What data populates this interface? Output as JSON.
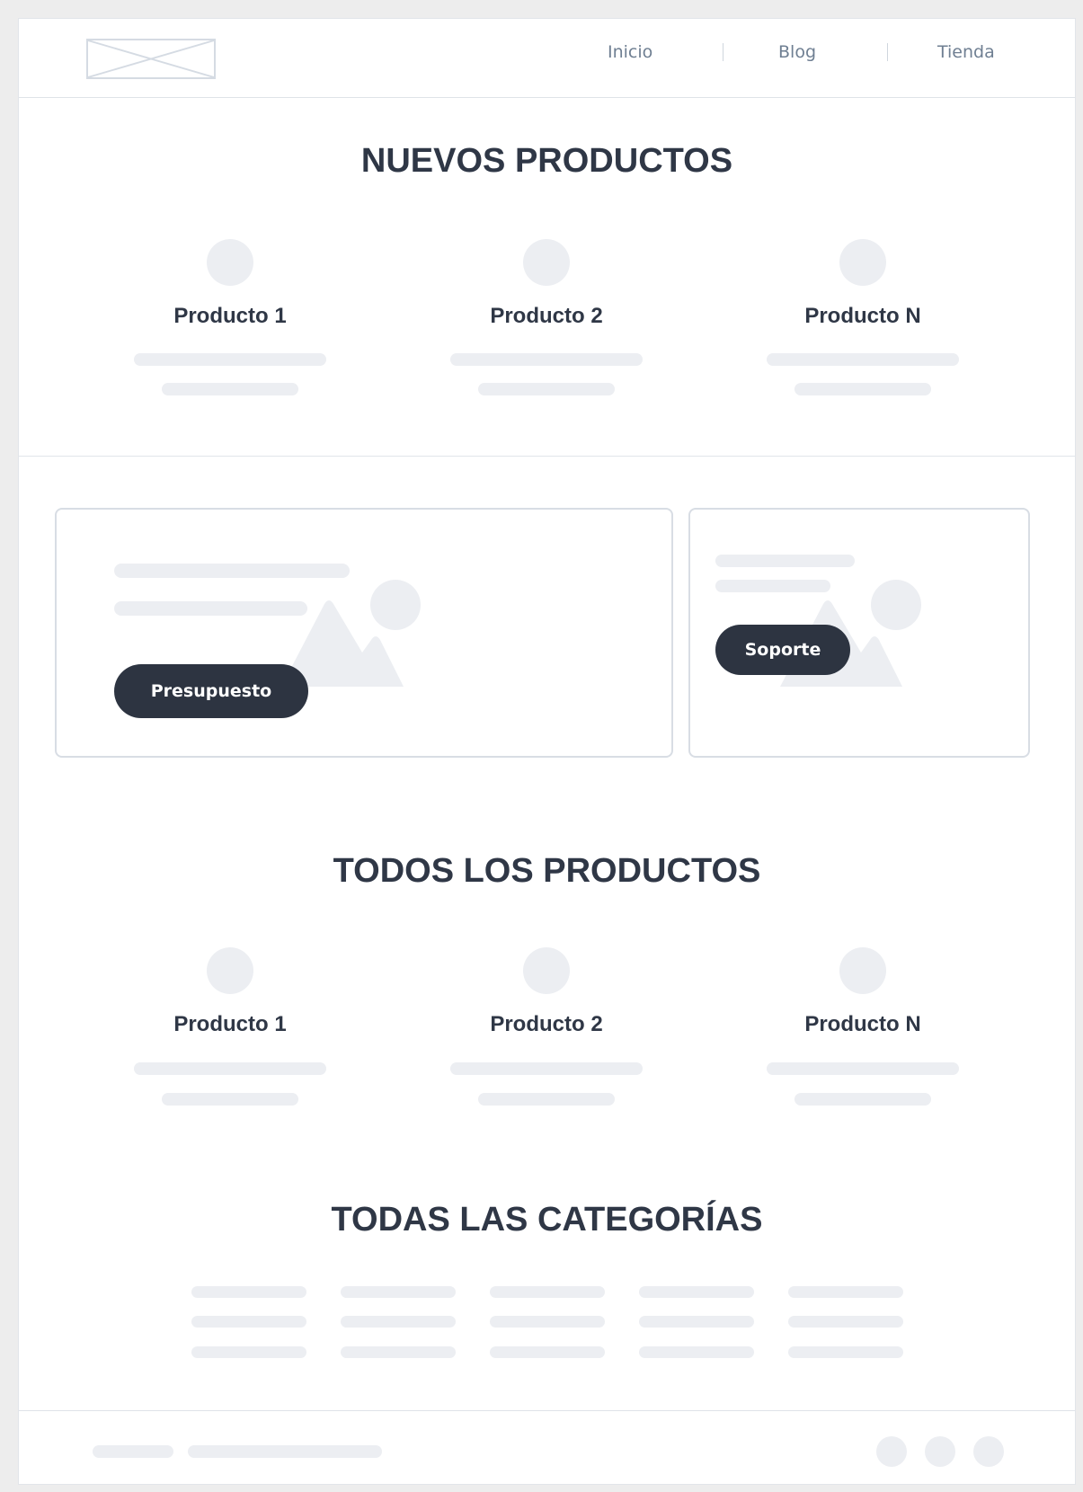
{
  "header": {
    "nav": [
      "Inicio",
      "Blog",
      "Tienda"
    ]
  },
  "nuevos": {
    "title": "NUEVOS PRODUCTOS",
    "products": [
      "Producto 1",
      "Producto 2",
      "Producto N"
    ]
  },
  "promo": {
    "presupuesto_label": "Presupuesto",
    "soporte_label": "Soporte"
  },
  "todos": {
    "title": "TODOS LOS PRODUCTOS",
    "products": [
      "Producto 1",
      "Producto 2",
      "Producto N"
    ]
  },
  "categorias": {
    "title": "TODAS LAS CATEGORÍAS"
  },
  "icons": {
    "logo": "logo-placeholder-icon",
    "image": "image-placeholder-icon"
  },
  "colors": {
    "placeholder": "#eceef2",
    "dark_button": "#2d3441",
    "heading": "#2f3746"
  }
}
